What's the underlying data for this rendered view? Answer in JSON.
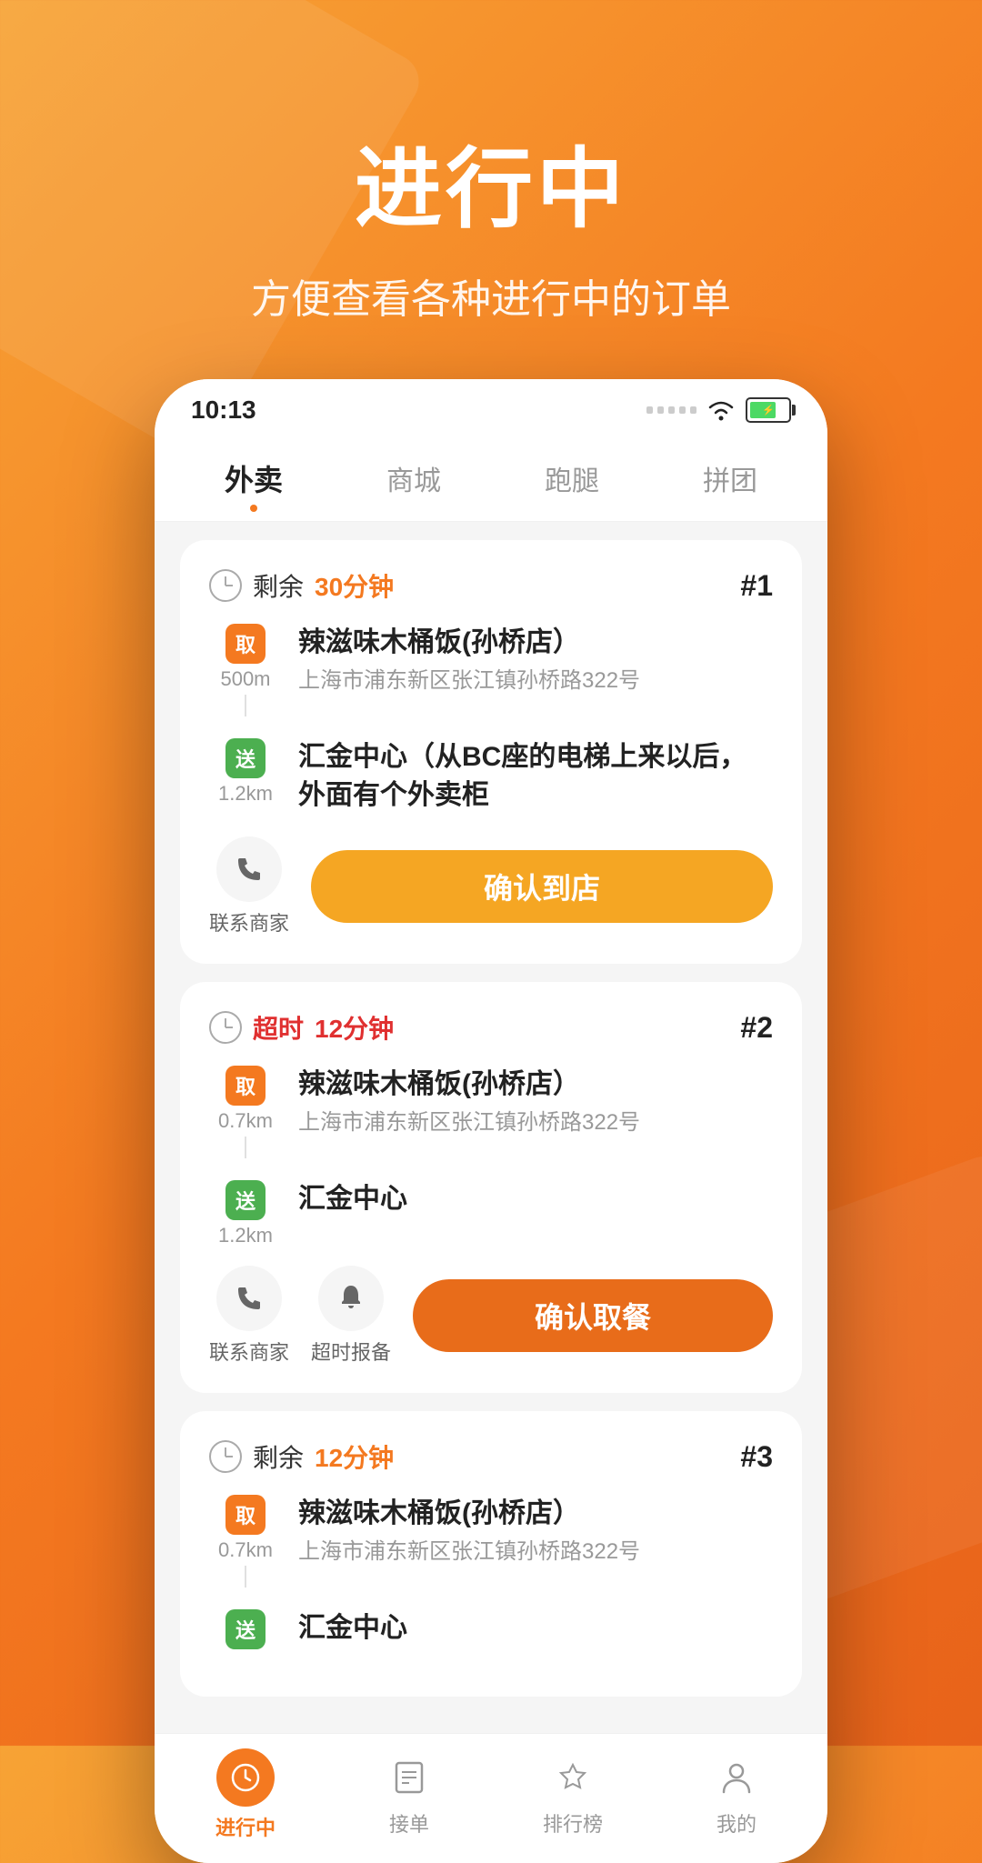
{
  "header": {
    "title": "进行中",
    "subtitle": "方便查看各种进行中的订单"
  },
  "status_bar": {
    "time": "10:13",
    "direction_icon": "▶"
  },
  "tabs": [
    {
      "label": "外卖",
      "active": true
    },
    {
      "label": "商城",
      "active": false
    },
    {
      "label": "跑腿",
      "active": false
    },
    {
      "label": "拼团",
      "active": false
    }
  ],
  "orders": [
    {
      "id": "#1",
      "time_label": "剩余",
      "time_value": "30分钟",
      "time_status": "normal",
      "pickup": {
        "badge": "取",
        "distance": "500m",
        "name": "辣滋味木桶饭(孙桥店）",
        "address": "上海市浦东新区张江镇孙桥路322号"
      },
      "delivery": {
        "badge": "送",
        "distance": "1.2km",
        "name": "汇金中心（从BC座的电梯上来以后，外面有个外卖柜",
        "address": ""
      },
      "actions": {
        "contact_label": "联系商家",
        "confirm_label": "确认到店",
        "confirm_style": "normal"
      }
    },
    {
      "id": "#2",
      "time_label": "超时",
      "time_value": "12分钟",
      "time_status": "red",
      "pickup": {
        "badge": "取",
        "distance": "0.7km",
        "name": "辣滋味木桶饭(孙桥店）",
        "address": "上海市浦东新区张江镇孙桥路322号"
      },
      "delivery": {
        "badge": "送",
        "distance": "1.2km",
        "name": "汇金中心",
        "address": ""
      },
      "actions": {
        "contact_label": "联系商家",
        "alarm_label": "超时报备",
        "confirm_label": "确认取餐",
        "confirm_style": "dark"
      }
    },
    {
      "id": "#3",
      "time_label": "剩余",
      "time_value": "12分钟",
      "time_status": "orange",
      "pickup": {
        "badge": "取",
        "distance": "0.7km",
        "name": "辣滋味木桶饭(孙桥店）",
        "address": "上海市浦东新区张江镇孙桥路322号"
      },
      "delivery": {
        "badge": "送",
        "distance": "",
        "name": "汇金中心",
        "address": ""
      }
    }
  ],
  "bottom_nav": [
    {
      "label": "进行中",
      "active": true,
      "icon": "ongoing"
    },
    {
      "label": "接单",
      "active": false,
      "icon": "order"
    },
    {
      "label": "排行榜",
      "active": false,
      "icon": "rank"
    },
    {
      "label": "我的",
      "active": false,
      "icon": "profile"
    }
  ]
}
